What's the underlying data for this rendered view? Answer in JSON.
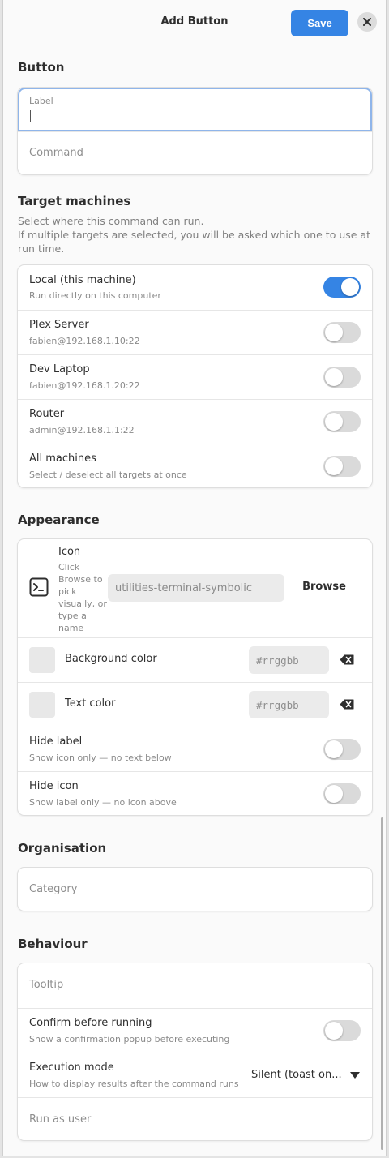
{
  "header": {
    "title": "Add Button",
    "save_label": "Save"
  },
  "button_section": {
    "title": "Button",
    "label_field": {
      "floating_label": "Label",
      "value": ""
    },
    "command_placeholder": "Command"
  },
  "targets": {
    "title": "Target machines",
    "description_line1": "Select where this command can run.",
    "description_line2": "If multiple targets are selected, you will be asked which one to use at run time.",
    "items": [
      {
        "label": "Local (this machine)",
        "sub": "Run directly on this computer",
        "enabled": true
      },
      {
        "label": "Plex Server",
        "sub": "fabien@192.168.1.10:22",
        "enabled": false
      },
      {
        "label": "Dev Laptop",
        "sub": "fabien@192.168.1.20:22",
        "enabled": false
      },
      {
        "label": "Router",
        "sub": "admin@192.168.1.1:22",
        "enabled": false
      },
      {
        "label": "All machines",
        "sub": "Select / deselect all targets at once",
        "enabled": false
      }
    ]
  },
  "appearance": {
    "title": "Appearance",
    "icon": {
      "label": "Icon",
      "sub": "Click Browse to pick visually, or type a name",
      "placeholder": "utilities-terminal-symbolic",
      "browse_label": "Browse",
      "preview_icon": "terminal-icon"
    },
    "background_color": {
      "label": "Background color",
      "placeholder": "#rrggbb"
    },
    "text_color": {
      "label": "Text color",
      "placeholder": "#rrggbb"
    },
    "hide_label": {
      "label": "Hide label",
      "sub": "Show icon only — no text below",
      "enabled": false
    },
    "hide_icon": {
      "label": "Hide icon",
      "sub": "Show label only — no icon above",
      "enabled": false
    }
  },
  "organisation": {
    "title": "Organisation",
    "category_placeholder": "Category"
  },
  "behaviour": {
    "title": "Behaviour",
    "tooltip_placeholder": "Tooltip",
    "confirm": {
      "label": "Confirm before running",
      "sub": "Show a confirmation popup before executing",
      "enabled": false
    },
    "execution_mode": {
      "label": "Execution mode",
      "sub": "How to display results after the command runs",
      "value": "Silent (toast on..."
    },
    "run_as_placeholder": "Run as user"
  },
  "colors": {
    "accent": "#3584e4",
    "switch_off": "#dadada"
  }
}
